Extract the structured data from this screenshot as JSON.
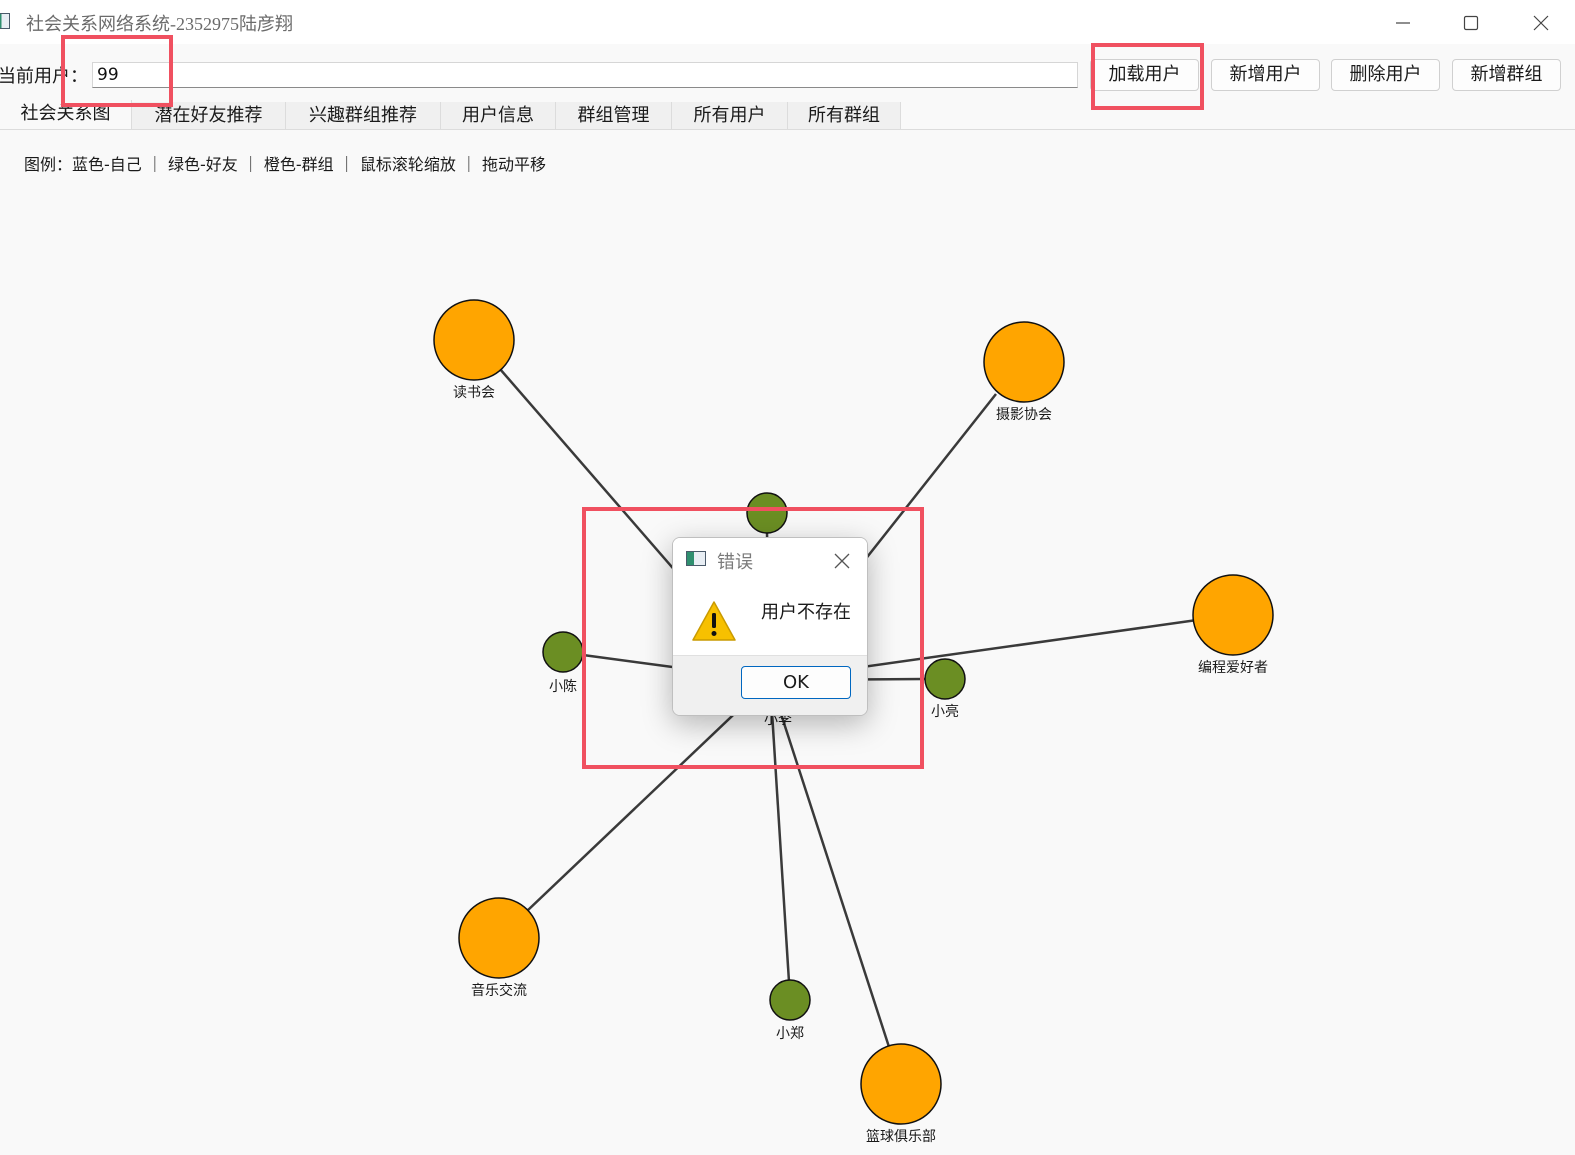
{
  "window": {
    "title": "社会关系网络系统-2352975陆彦翔",
    "icon": "app-window-icon",
    "controls": [
      "minimize-icon",
      "maximize-icon",
      "close-icon"
    ]
  },
  "toolbar": {
    "current_user_label": "当前用户：",
    "current_user_value": "99",
    "buttons": [
      "加载用户",
      "新增用户",
      "删除用户",
      "新增群组"
    ]
  },
  "tabs": [
    "社会关系图",
    "潜在好友推荐",
    "兴趣群组推荐",
    "用户信息",
    "群组管理",
    "所有用户",
    "所有群组"
  ],
  "active_tab": "社会关系图",
  "legend": "图例：蓝色-自己 ｜ 绿色-好友 ｜ 橙色-群组 ｜ 鼠标滚轮缩放 ｜ 拖动平移",
  "graph": {
    "colors": {
      "friend": "#6b8e23",
      "group": "#ffa500",
      "edge": "#3a3a3a"
    },
    "center_label": "小李",
    "friends": [
      "小陈",
      "小亮",
      "小郑"
    ],
    "groups": [
      "读书会",
      "摄影协会",
      "编程爱好者",
      "音乐交流",
      "篮球俱乐部"
    ]
  },
  "dialog": {
    "title": "错误",
    "message": "用户不存在",
    "ok_label": "OK",
    "icon": "warning-icon"
  },
  "annotation_color": "#f05060"
}
